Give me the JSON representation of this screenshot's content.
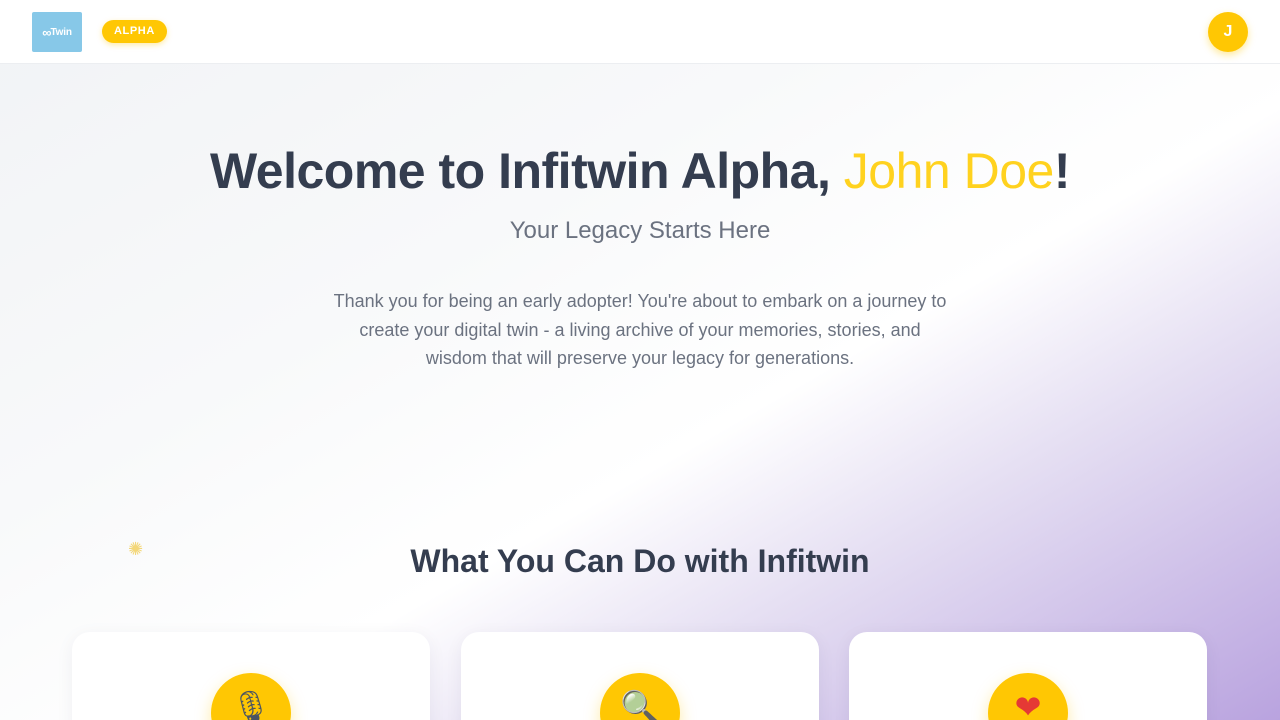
{
  "header": {
    "logo_symbol": "∞",
    "logo_text": "Twin",
    "badge": "ALPHA",
    "avatar_initial": "J"
  },
  "hero": {
    "title_prefix": "Welcome to Infitwin Alpha, ",
    "user_name": "John Doe",
    "title_suffix": "!",
    "subtitle": "Your Legacy Starts Here",
    "intro": "Thank you for being an early adopter! You're about to embark on a journey to create your digital twin - a living archive of your memories, stories, and wisdom that will preserve your legacy for generations."
  },
  "features": {
    "title": "What You Can Do with Infitwin",
    "cards": [
      {
        "icon": "microphone-icon",
        "glyph": "🎙"
      },
      {
        "icon": "magnifier-icon",
        "glyph": "🔍"
      },
      {
        "icon": "heart-icon",
        "glyph": "❤"
      }
    ]
  },
  "colors": {
    "accent": "#ffc703",
    "name_highlight": "#ffd21f",
    "heading": "#343d4f",
    "muted_text": "#6b7280",
    "logo_bg": "#87c8e8"
  }
}
